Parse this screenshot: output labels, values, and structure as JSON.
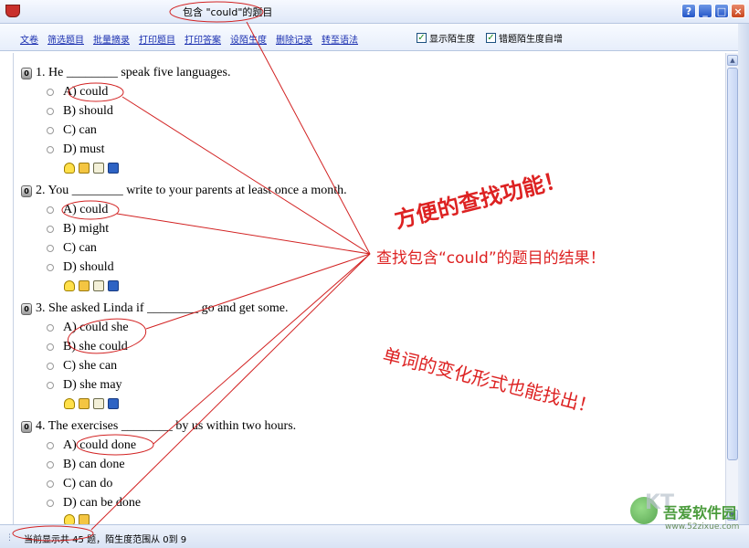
{
  "window": {
    "title": "包含 \"could\"的题目"
  },
  "toolbar": {
    "menu": [
      "文卷",
      "筛选题目",
      "批量摘录",
      "打印题目",
      "打印答案",
      "设陌生度",
      "删除记录",
      "转至语法"
    ],
    "checkboxes": [
      {
        "label": "显示陌生度",
        "checked": true
      },
      {
        "label": "错题陌生度自增",
        "checked": true
      }
    ]
  },
  "questions": [
    {
      "badge": "0",
      "text": "1. He ________ speak five languages.",
      "options": [
        "A) could",
        "B) should",
        "C) can",
        "D) must"
      ]
    },
    {
      "badge": "0",
      "text": "2. You ________ write to your parents at least once a month.",
      "options": [
        "A) could",
        "B) might",
        "C) can",
        "D) should"
      ]
    },
    {
      "badge": "0",
      "text": "3. She asked Linda if ________ go and get some.",
      "options": [
        "A) could she",
        "B) she could",
        "C) she can",
        "D) she may"
      ]
    },
    {
      "badge": "0",
      "text": "4. The exercises ________ by us within two hours.",
      "options": [
        "A) could done",
        "B) can done",
        "C) can do",
        "D) can be done"
      ]
    }
  ],
  "question_icons": [
    "lightbulb-icon",
    "star-icon",
    "note-icon",
    "save-icon"
  ],
  "status": {
    "text": "当前显示共 45 题，陌生度范围从 0到 9"
  },
  "annotations": {
    "headline": "方便的查找功能！",
    "result": "查找包含“could”的题目的结果！",
    "variants": "单词的变化形式也能找出！",
    "color": "#d22222"
  },
  "watermark": {
    "brand": "吾爱软件园",
    "url": "www.52zixue.com",
    "logo_text": "KT"
  }
}
